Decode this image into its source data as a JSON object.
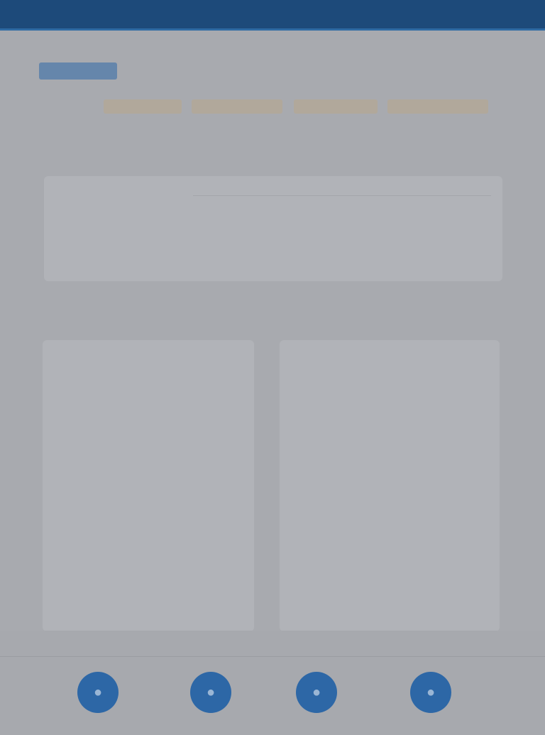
{
  "topbar": {
    "title": "",
    "meta": ""
  },
  "header": {
    "logo_text": "",
    "logo_sub": "",
    "links": [
      "",
      ""
    ]
  },
  "filters": {
    "label": "",
    "pills": [
      "",
      "",
      "",
      ""
    ]
  },
  "summary": {
    "title": "",
    "subtitle": "",
    "metrics": [
      {
        "label": "",
        "value": ""
      },
      {
        "label": "",
        "value": ""
      },
      {
        "label": "",
        "value": ""
      }
    ]
  },
  "left_column": {
    "title": "",
    "items": [
      "",
      "",
      "",
      "",
      "",
      "",
      "",
      "",
      ""
    ]
  },
  "right_column": {
    "title": "",
    "items": [
      "",
      "",
      "",
      "",
      "",
      "",
      "",
      ""
    ]
  },
  "bottom_nav": [
    {
      "icon": "circle-icon",
      "glyph": "●"
    },
    {
      "icon": "circle-icon",
      "glyph": "●"
    },
    {
      "icon": "circle-icon",
      "glyph": "●"
    },
    {
      "icon": "circle-icon",
      "glyph": "●"
    }
  ],
  "colors": {
    "topbar": "#1d4a7a",
    "accent": "#2e67a8",
    "pill": "#b7a68e",
    "panel": "#b1b3b8",
    "background": "#a8aaaf"
  }
}
